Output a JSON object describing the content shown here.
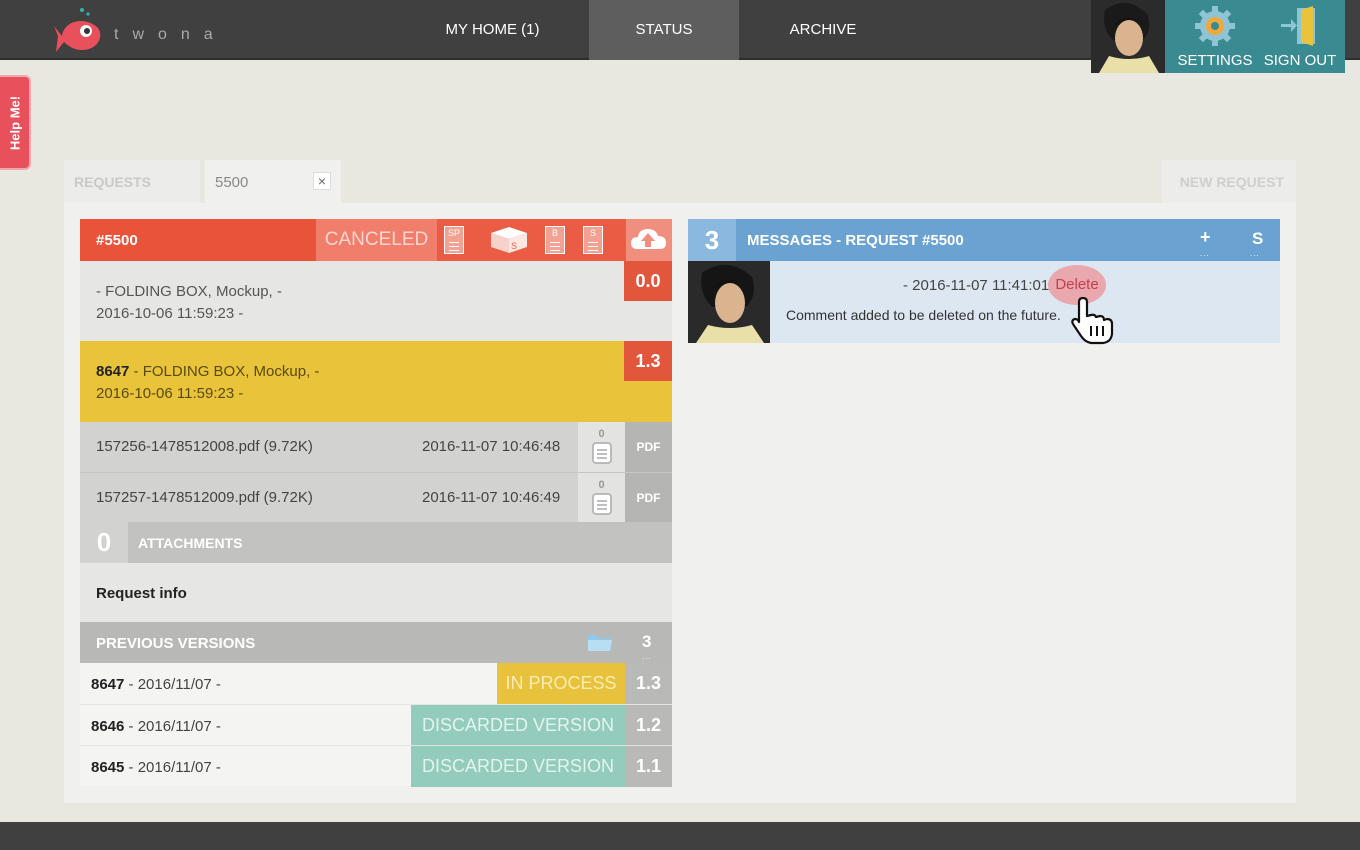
{
  "brand": {
    "name": "twona"
  },
  "nav": {
    "home": "MY HOME (1)",
    "status": "STATUS",
    "archive": "ARCHIVE"
  },
  "user_menu": {
    "settings": "SETTINGS",
    "sign_out": "SIGN OUT"
  },
  "help_tab": "Help Me!",
  "tabs": {
    "requests": "REQUESTS",
    "current": "5500",
    "close": "×",
    "new_request": "NEW REQUEST"
  },
  "request": {
    "id": "#5500",
    "status": "CANCELED",
    "doc_icons": [
      "SP",
      "S",
      "B",
      "S"
    ],
    "versions": [
      {
        "code": "",
        "desc": "- FOLDING BOX, Mockup, -",
        "date": "2016-10-06 11:59:23 -",
        "badge": "0.0"
      },
      {
        "code": "8647",
        "desc": " - FOLDING BOX, Mockup, -",
        "date": "2016-10-06 11:59:23 -",
        "badge": "1.3"
      }
    ],
    "files": [
      {
        "name": "157256-1478512008.pdf (9.72K)",
        "date": "2016-11-07 10:46:48",
        "count": "0",
        "type": "PDF"
      },
      {
        "name": "157257-1478512009.pdf (9.72K)",
        "date": "2016-11-07 10:46:49",
        "count": "0",
        "type": "PDF"
      }
    ],
    "attachments": {
      "count": "0",
      "label": "ATTACHMENTS"
    },
    "info_label": "Request info",
    "previous": {
      "label": "PREVIOUS VERSIONS",
      "count": "3",
      "rows": [
        {
          "code": "8647",
          "date": " - 2016/11/07 -",
          "status": "IN PROCESS",
          "ver": "1.3"
        },
        {
          "code": "8646",
          "date": " - 2016/11/07 -",
          "status": "DISCARDED VERSION",
          "ver": "1.2"
        },
        {
          "code": "8645",
          "date": " - 2016/11/07 -",
          "status": "DISCARDED VERSION",
          "ver": "1.1"
        }
      ]
    }
  },
  "messages": {
    "count": "3",
    "title": "MESSAGES - REQUEST #5500",
    "add": "+",
    "s": "S",
    "dots": "...",
    "items": [
      {
        "date": "- 2016-11-07 11:41:01",
        "delete": "Delete",
        "text": "Comment added to be deleted on the future."
      }
    ]
  },
  "colors": {
    "topbar": "#404040",
    "canceled": "#e9533a",
    "in_process": "#e9c33a",
    "discarded": "#93ccbc",
    "messages": "#6aa2d2",
    "settings_bg": "#3a8a91",
    "help": "#e8505b"
  }
}
